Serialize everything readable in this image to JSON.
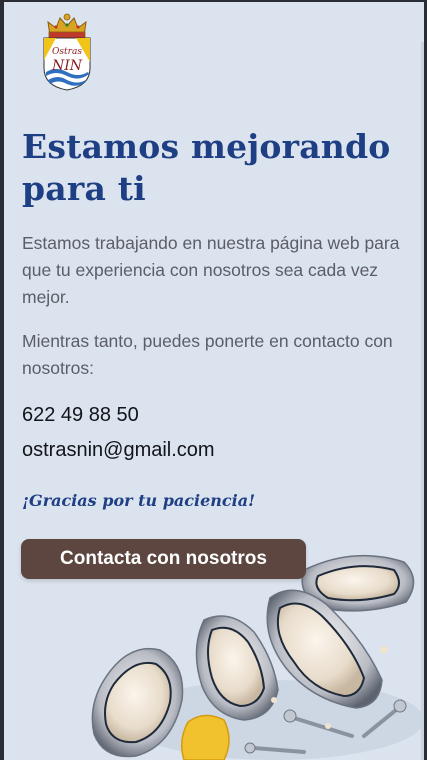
{
  "logo": {
    "text_top": "Ostras",
    "text_bottom": "NIN"
  },
  "content": {
    "headline": "Estamos mejorando para ti",
    "paragraph_1": "Estamos trabajando en nuestra página web para que tu experiencia con nosotros sea cada vez mejor.",
    "paragraph_2": "Mientras tanto, puedes ponerte en contacto con nosotros:",
    "phone": "622 49 88 50",
    "email": "ostrasnin@gmail.com",
    "thanks": "¡Gracias por tu paciencia!",
    "cta_label": "Contacta con nosotros"
  },
  "colors": {
    "background": "#dbe3ef",
    "heading": "#1e3f84",
    "body_text": "#5b5e66",
    "button": "#5c463f",
    "button_text": "#ffffff"
  },
  "hero_image": {
    "subject": "oysters-and-wrenches-illustration"
  }
}
